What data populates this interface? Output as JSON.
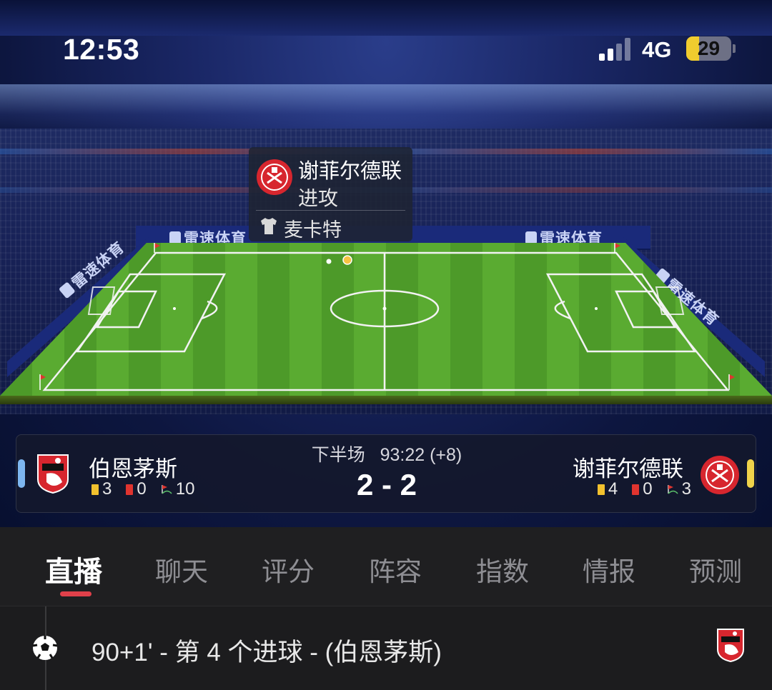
{
  "status_bar": {
    "time": "12:53",
    "network": "4G",
    "battery": "29",
    "battery_level": 0.29,
    "icons": [
      "signal-icon",
      "battery-icon"
    ]
  },
  "pitch": {
    "ad_boards": [
      "雷速体育",
      "雷速体育",
      "雷速体育",
      "雷速体育"
    ]
  },
  "tooltip": {
    "team": "谢菲尔德联",
    "action": "进攻",
    "player": "麦卡特",
    "icons": [
      "sheffield-united-crest-icon",
      "jersey-icon"
    ]
  },
  "match": {
    "period": "下半场",
    "clock": "93:22 (+8)",
    "score": "2 - 2",
    "home": {
      "name": "伯恩茅斯",
      "yellow_cards": "3",
      "red_cards": "0",
      "corners": "10",
      "color": "#7db6f0",
      "crest": "bournemouth-crest-icon"
    },
    "away": {
      "name": "谢菲尔德联",
      "yellow_cards": "4",
      "red_cards": "0",
      "corners": "3",
      "color": "#f0d34a",
      "crest": "sheffield-united-crest-icon"
    }
  },
  "tabs": [
    {
      "label": "直播",
      "active": true
    },
    {
      "label": "聊天",
      "active": false
    },
    {
      "label": "评分",
      "active": false
    },
    {
      "label": "阵容",
      "active": false
    },
    {
      "label": "指数",
      "active": false
    },
    {
      "label": "情报",
      "active": false
    },
    {
      "label": "预测",
      "active": false
    }
  ],
  "accent_color": "#e0404a",
  "events": [
    {
      "text": "90+1' - 第 4 个进球 - (伯恩茅斯)",
      "icon": "soccer-ball-icon",
      "team_crest": "bournemouth-crest-icon"
    }
  ]
}
